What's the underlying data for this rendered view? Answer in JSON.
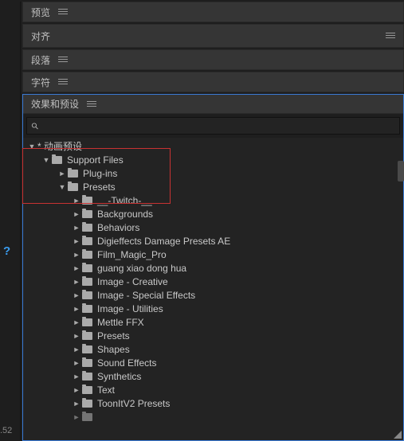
{
  "panels": {
    "preview": "预览",
    "align": "对齐",
    "paragraph": "段落",
    "character": "字符",
    "effects": "效果和预设"
  },
  "search_placeholder": "",
  "tree": {
    "root": "* 动画预设",
    "support_files": "Support Files",
    "plugins": "Plug-ins",
    "presets": "Presets",
    "children": [
      "__-Twitch-__",
      "Backgrounds",
      "Behaviors",
      "Digieffects Damage Presets AE",
      "Film_Magic_Pro",
      "guang xiao dong hua",
      "Image - Creative",
      "Image - Special Effects",
      "Image - Utilities",
      "Mettle FFX",
      "Presets",
      "Shapes",
      "Sound Effects",
      "Synthetics",
      "Text",
      "ToonItV2 Presets"
    ]
  },
  "help_icon": "?",
  "bottom_value": ".52"
}
